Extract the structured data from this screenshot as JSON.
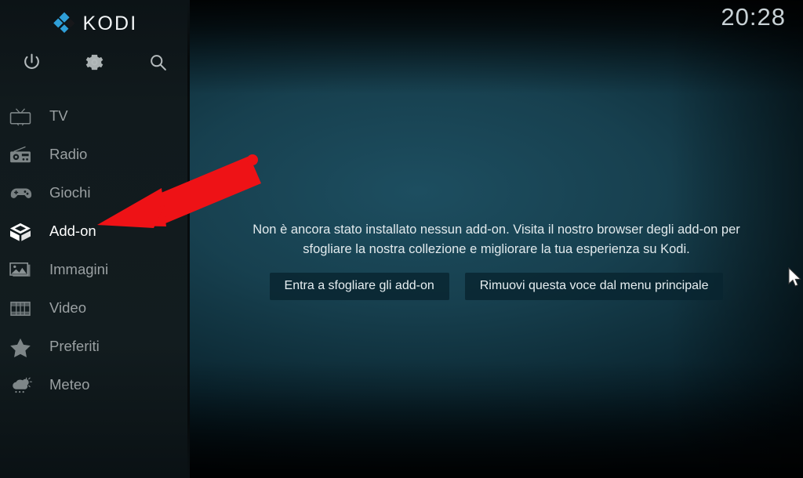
{
  "app": {
    "name": "KODI",
    "logo_icon": "kodi-logo-icon"
  },
  "header": {
    "clock": "20:28"
  },
  "toolbar": {
    "items": [
      {
        "icon": "power-icon",
        "label": "Power"
      },
      {
        "icon": "gear-icon",
        "label": "Settings"
      },
      {
        "icon": "search-icon",
        "label": "Search"
      }
    ]
  },
  "sidebar": {
    "items": [
      {
        "label": "TV",
        "icon": "tv-icon",
        "active": false
      },
      {
        "label": "Radio",
        "icon": "radio-icon",
        "active": false
      },
      {
        "label": "Giochi",
        "icon": "gamepad-icon",
        "active": false
      },
      {
        "label": "Add-on",
        "icon": "addon-box-icon",
        "active": true
      },
      {
        "label": "Immagini",
        "icon": "picture-icon",
        "active": false
      },
      {
        "label": "Video",
        "icon": "film-strip-icon",
        "active": false
      },
      {
        "label": "Preferiti",
        "icon": "star-icon",
        "active": false
      },
      {
        "label": "Meteo",
        "icon": "weather-cloud-icon",
        "active": false
      }
    ]
  },
  "main": {
    "empty_message": "Non è ancora stato installato nessun add-on. Visita il nostro browser degli add-on per sfogliare la nostra collezione e migliorare la tua esperienza su Kodi.",
    "buttons": {
      "browse": "Entra a sfogliare gli add-on",
      "remove": "Rimuovi questa voce dal menu principale"
    }
  },
  "annotation": {
    "arrow_color": "#ee1216",
    "type": "red-arrow-pointing-to-addon"
  },
  "colors": {
    "sidebar_bg": "#111a1d",
    "content_bg": "#1d4e60",
    "accent": "#3ab5e8",
    "active_text": "#ffffff",
    "inactive_text": "#9aa0a2"
  }
}
